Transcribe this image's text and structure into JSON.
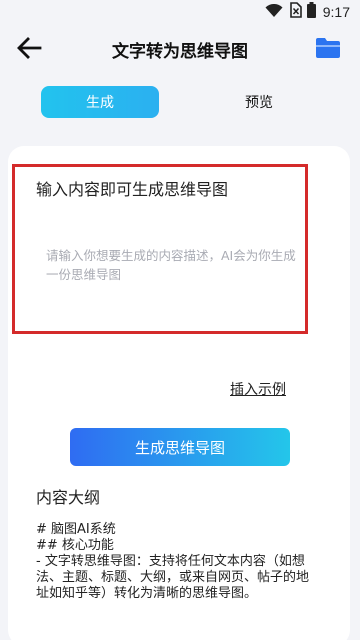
{
  "status_bar": {
    "time": "9:17",
    "icons": [
      "wifi-icon",
      "sim-no-signal-icon",
      "battery-icon"
    ]
  },
  "app_bar": {
    "title": "文字转为思维导图",
    "back_icon": "arrow-left-icon",
    "folder_icon": "folder-icon",
    "accent_color": "#2b74f0"
  },
  "tabs": [
    {
      "label": "生成",
      "active": true
    },
    {
      "label": "预览",
      "active": false
    }
  ],
  "input": {
    "title": "输入内容即可生成思维导图",
    "placeholder": "请输入你想要生成的内容描述，AI会为你生成一份思维导图",
    "highlight_color": "#d42a2a"
  },
  "insert_example_label": "插入示例",
  "generate_button_label": "生成思维导图",
  "outline": {
    "title": "内容大纲",
    "lines": [
      "# 脑图AI系统",
      "## 核心功能",
      "- 文字转思维导图：支持将任何文本内容（如想法、主题、标题、大纲，或来自网页、帖子的地址如知乎等）转化为清晰的思维导图。"
    ]
  }
}
